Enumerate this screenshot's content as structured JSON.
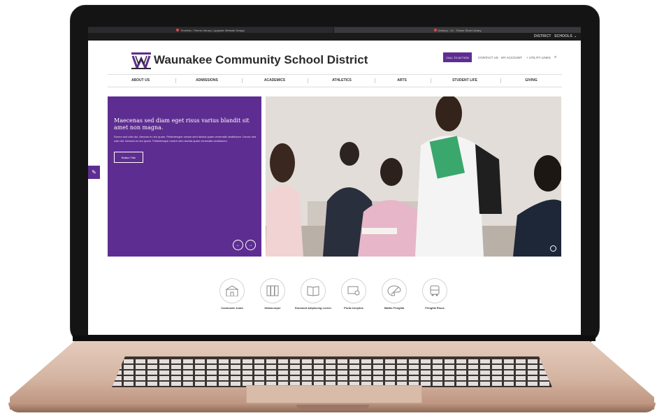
{
  "browser": {
    "tabs": [
      {
        "label": "Timeline | Theme Library | Upgrade Website Design"
      },
      {
        "label": "Darbury - v3 - Theme Store Library"
      }
    ]
  },
  "utility_bar": {
    "district": "DISTRICT",
    "schools": "SCHOOLS"
  },
  "header": {
    "title": "Waunakee Community School District",
    "cta": "CALL TO ACTION",
    "contact": "CONTACT US",
    "account": "MY ACCOUNT",
    "utility_links": "+ UTILITY LINKS"
  },
  "nav": {
    "items": [
      "ABOUT US",
      "ADMISSIONS",
      "ACADEMICS",
      "ATHLETICS",
      "ARTS",
      "STUDENT LIFE",
      "GIVING"
    ]
  },
  "hero": {
    "title": "Maecenas sed diam eget risus varius blandit sit amet non magna.",
    "text": "Donec sed odio dui. Aenean eu leo quam. Pellentesque ornare sem lacinia quam venenatis vestibulum. Donec sed odio dui. Aenean eu leo quam. Pellentesque ornare sem lacinia quam venenatis vestibulum.",
    "button": "Button Title",
    "prev": "←",
    "next": "→"
  },
  "quick_links": [
    {
      "label": "Commodo Justo",
      "icon": "school-building-icon"
    },
    {
      "label": "Ullamcorper",
      "icon": "lockers-icon"
    },
    {
      "label": "Euismod Adipiscing Lorem",
      "icon": "book-icon"
    },
    {
      "label": "Porta Inceptos",
      "icon": "classroom-icon"
    },
    {
      "label": "Mattis Fringilla",
      "icon": "palette-icon"
    },
    {
      "label": "Fringilla Risus",
      "icon": "bus-icon"
    }
  ],
  "colors": {
    "brand": "#5e2d91",
    "dark": "#1b1b1b"
  }
}
